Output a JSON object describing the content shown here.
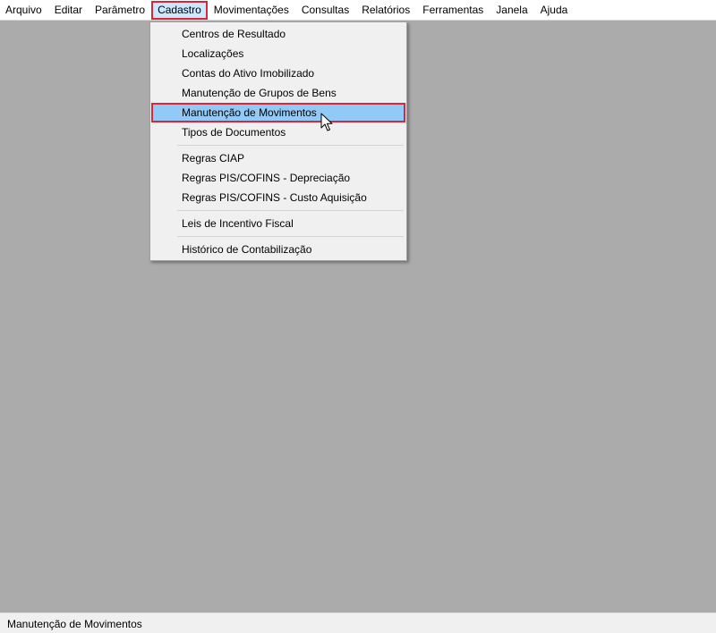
{
  "menubar": {
    "items": [
      "Arquivo",
      "Editar",
      "Parâmetro",
      "Cadastro",
      "Movimentações",
      "Consultas",
      "Relatórios",
      "Ferramentas",
      "Janela",
      "Ajuda"
    ],
    "active": "Cadastro"
  },
  "cadastro_menu": {
    "groups": [
      [
        "Centros de Resultado",
        "Localizações",
        "Contas do Ativo Imobilizado",
        "Manutenção de Grupos de Bens",
        "Manutenção de Movimentos",
        "Tipos de Documentos"
      ],
      [
        "Regras CIAP",
        "Regras PIS/COFINS - Depreciação",
        "Regras PIS/COFINS - Custo Aquisição"
      ],
      [
        "Leis de Incentivo Fiscal"
      ],
      [
        "Histórico de Contabilização"
      ]
    ],
    "highlighted": "Manutenção de Movimentos"
  },
  "statusbar": {
    "text": "Manutenção de Movimentos"
  },
  "colors": {
    "highlight": "#91c9f7",
    "outline": "#d6283a",
    "workspace": "#ababab"
  },
  "icons": {
    "cursor": "mouse-pointer-icon"
  }
}
